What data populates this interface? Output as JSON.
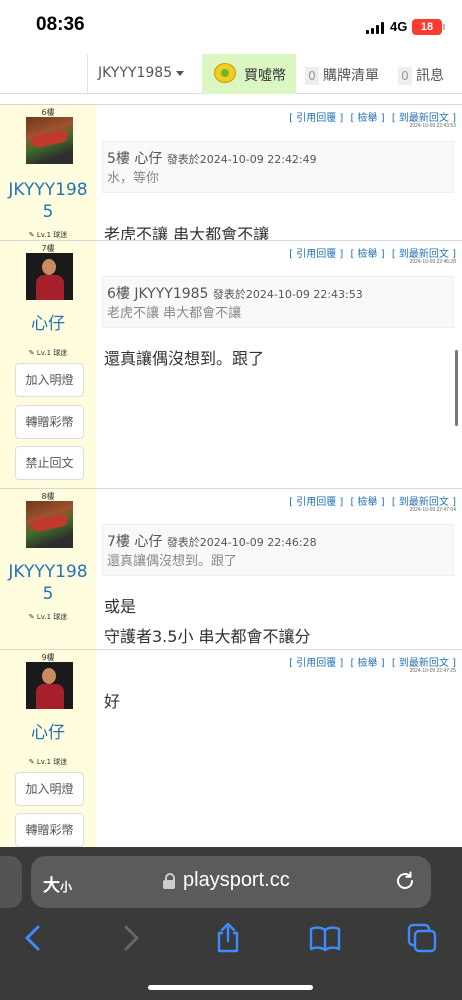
{
  "status": {
    "time": "08:36",
    "network": "4G",
    "battery": "18"
  },
  "nav": {
    "username": "JKYYY1985",
    "coin_label": "買噓幣",
    "cart_count": "0",
    "cart_label": "購牌清單",
    "msg_count": "0",
    "msg_label": "訊息"
  },
  "actions": {
    "quote_reply": "[ 引用回覆 ]",
    "report": "[ 檢舉 ]",
    "latest": "[ 到最新回文 ]"
  },
  "posts": [
    {
      "floor": "6樓",
      "author": "JKYYY1985",
      "author_l1": "JKYYY198",
      "author_l2": "5",
      "level": "Lv.1 球迷",
      "timestamp": "2024-10-09 22:43:53",
      "quote_head": "5樓 心仔",
      "quote_meta": "發表於2024-10-09 22:42:49",
      "quote_body": "水，等你",
      "text": [
        "老虎不讓 串大都會不讓"
      ]
    },
    {
      "floor": "7樓",
      "author": "心仔",
      "level": "Lv.1 球迷",
      "timestamp": "2024-10-09 22:46:28",
      "buttons": [
        "加入明燈",
        "轉贈彩幣",
        "禁止回文"
      ],
      "quote_head": "6樓 JKYYY1985",
      "quote_meta": "發表於2024-10-09 22:43:53",
      "quote_body": "老虎不讓 串大都會不讓",
      "text": [
        "還真讓偶沒想到。跟了"
      ]
    },
    {
      "floor": "8樓",
      "author": "JKYYY1985",
      "author_l1": "JKYYY198",
      "author_l2": "5",
      "level": "Lv.1 球迷",
      "timestamp": "2024-10-09 22:47:04",
      "quote_head": "7樓 心仔",
      "quote_meta": "發表於2024-10-09 22:46:28",
      "quote_body": "還真讓偶沒想到。跟了",
      "text": [
        "或是",
        "守護者3.5小 串大都會不讓分"
      ]
    },
    {
      "floor": "9樓",
      "author": "心仔",
      "level": "Lv.1 球迷",
      "timestamp": "2024-10-09 22:47:25",
      "buttons": [
        "加入明燈",
        "轉贈彩幣"
      ],
      "text": [
        "好"
      ]
    }
  ],
  "browser": {
    "text_size": "大",
    "text_size_small": "小",
    "url": "playsport.cc"
  }
}
